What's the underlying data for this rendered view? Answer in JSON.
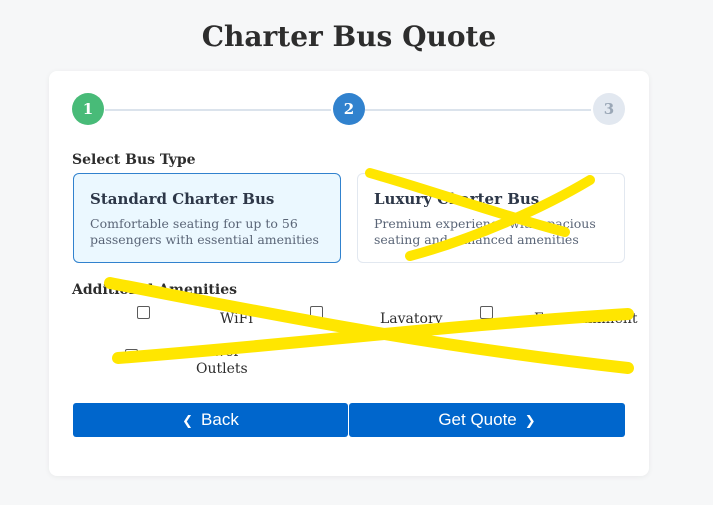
{
  "page": {
    "title": "Charter Bus Quote"
  },
  "stepper": {
    "steps": [
      "1",
      "2",
      "3"
    ],
    "current": 2,
    "colors": {
      "complete": "#48bb78",
      "active": "#3182ce",
      "pending": "#e2e8f0"
    }
  },
  "bus_type": {
    "label": "Select Bus Type",
    "options": [
      {
        "title": "Standard Charter Bus",
        "description": "Comfortable seating for up to 56 passengers with essential amenities",
        "selected": true
      },
      {
        "title": "Luxury Charter Bus",
        "description": "Premium experience with spacious seating and enhanced amenities",
        "selected": false
      }
    ]
  },
  "amenities": {
    "label": "Additional Amenities",
    "items": [
      {
        "label": "WiFi",
        "checked": false
      },
      {
        "label": "Lavatory",
        "checked": false
      },
      {
        "label": "Entertainment",
        "checked": false
      },
      {
        "label": "Power Outlets",
        "checked": false
      }
    ]
  },
  "actions": {
    "back_label": "Back",
    "quote_label": "Get Quote",
    "back_icon": "chevron-left-icon",
    "quote_icon": "chevron-right-icon",
    "color": "#0066cc"
  },
  "annotation_color": "#ffe600"
}
